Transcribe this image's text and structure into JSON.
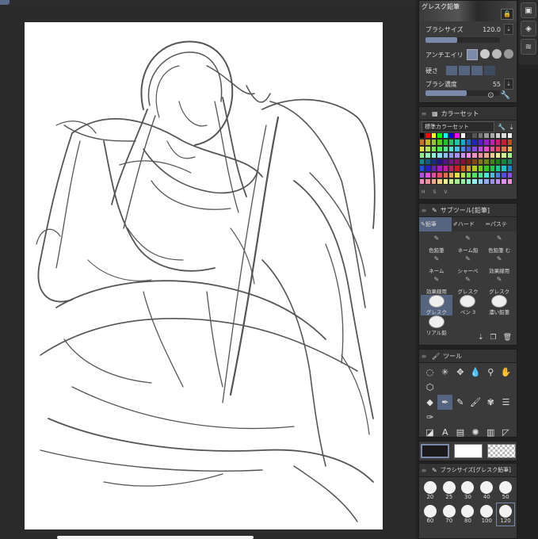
{
  "canvas": {
    "title_text": "",
    "paper_color": "#ffffff"
  },
  "brush_panel": {
    "brush_name": "グレスク鉛筆",
    "size_label": "ブラシサイズ",
    "size_value": "120.0",
    "antialias_label": "アンチエイリ",
    "hardness_label": "硬さ",
    "density_label": "ブラシ濃度",
    "density_value": "55"
  },
  "color_set": {
    "title": "カラーセット",
    "set_name": "標準カラーセット",
    "bottom_labels": [
      "H",
      "S",
      "V"
    ]
  },
  "sub_tool": {
    "title": "サブツール[鉛筆]",
    "tabs": [
      "鉛筆",
      "ハード",
      "パステ"
    ],
    "items": [
      {
        "label": "色鉛筆"
      },
      {
        "label": "ネーム鉛"
      },
      {
        "label": "色鉛筆 む"
      },
      {
        "label": "ネーム"
      },
      {
        "label": "シャーペ"
      },
      {
        "label": "効果線用"
      },
      {
        "label": "効果線用"
      },
      {
        "label": "グレスク"
      },
      {
        "label": "グレスク"
      },
      {
        "label": "グレスク"
      },
      {
        "label": "ペン 3"
      },
      {
        "label": "濃い鉛筆"
      },
      {
        "label": "リアル鉛"
      }
    ]
  },
  "tool_panel": {
    "title": "ツール"
  },
  "brush_size_panel": {
    "title": "ブラシサイズ[グレスク鉛筆]",
    "sizes": [
      "20",
      "25",
      "30",
      "40",
      "50",
      "60",
      "70",
      "80",
      "100",
      "120"
    ]
  },
  "colors": {
    "accent": "#7a8aa8",
    "panel_bg": "#3a3a3a",
    "main_color": "#1a1a1a",
    "sub_color": "#ffffff"
  }
}
